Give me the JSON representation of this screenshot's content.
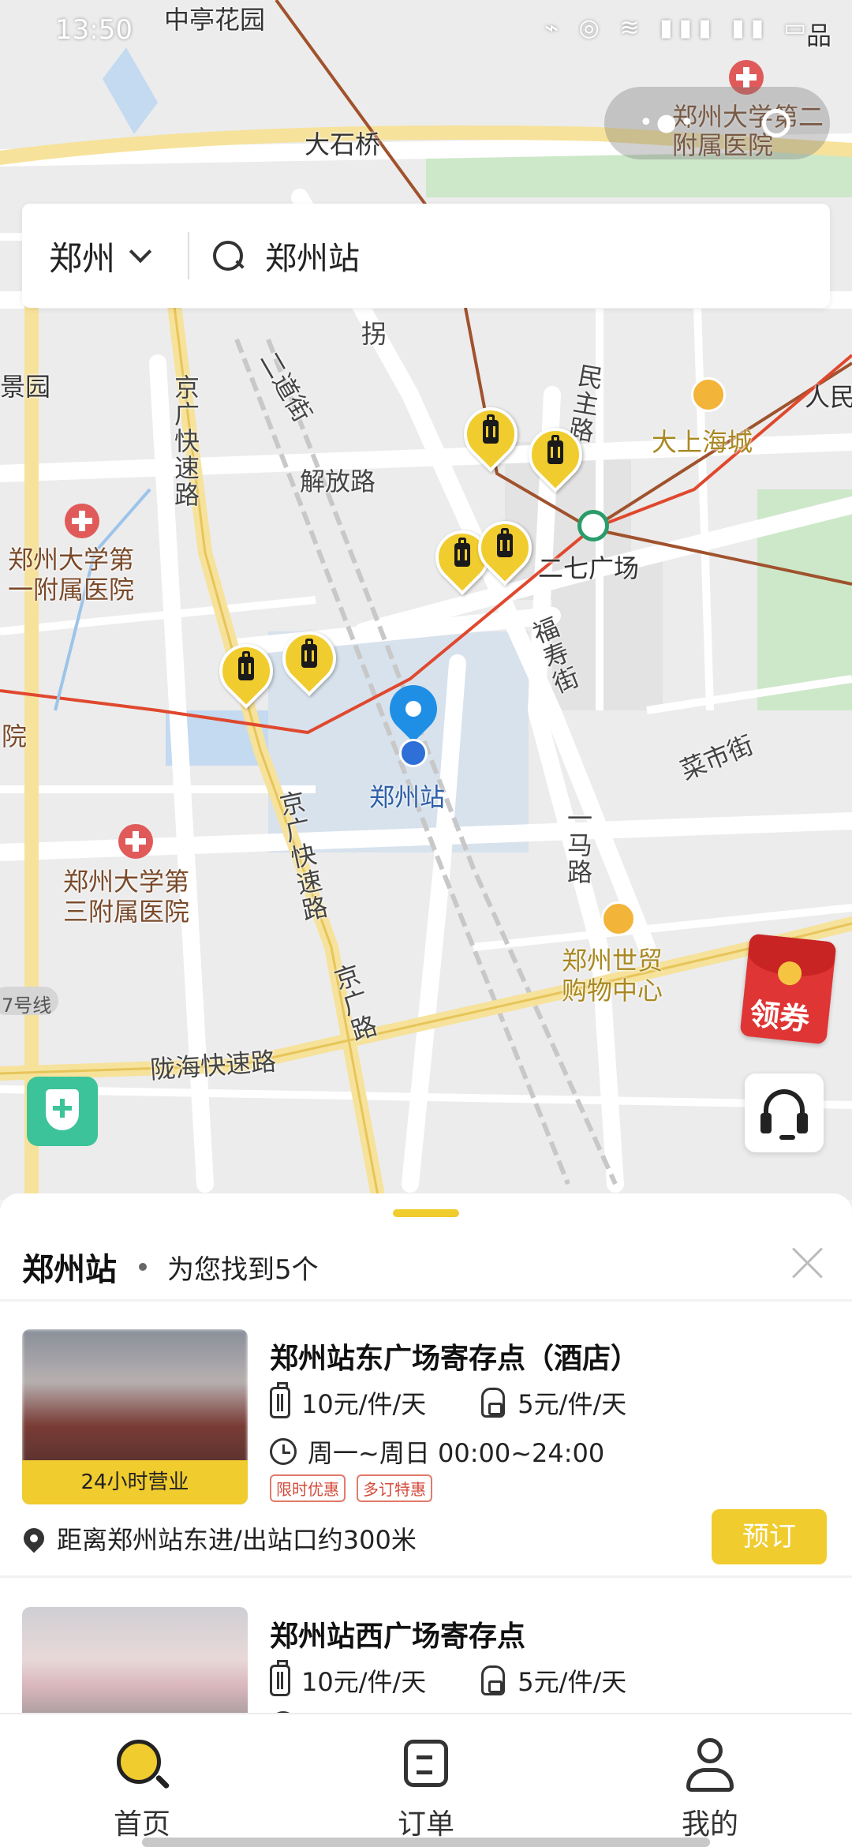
{
  "status_bar": {
    "time": "13:50",
    "icons": "⌁ ◎ ≋ ▮▮▮ ▮▮ ▭"
  },
  "search": {
    "city": "郑州",
    "query": "郑州站"
  },
  "map": {
    "labels": {
      "zhongting": "中亭花园",
      "dashiqiao": "大石桥",
      "hosp2": "郑州大学第二附属医院",
      "hosp1": "郑州大学第一附属医院",
      "hosp3": "郑州大学第三附属医院",
      "jinggang_exp1": "京广快速路",
      "jinggang_exp2": "京广快速路",
      "jinggang_rd": "京广路",
      "erdao": "二道街",
      "jiefang": "解放路",
      "minzhu": "民主路",
      "dashanghai": "大上海城",
      "erqi": "二七广场",
      "fushou": "福寿街",
      "caishi": "菜市街",
      "yima": "一马路",
      "shimao": "郑州世贸购物中心",
      "longhai": "陇海快速路",
      "station": "郑州站",
      "renmin": "人民",
      "jingyuan": "景园",
      "yuan": "院",
      "pinzhi": "品",
      "guai": "拐",
      "line7": "7号线"
    },
    "coupon_label": "领券",
    "colors": {
      "pin": "#f0cc2e",
      "metro_line": "#e0482e",
      "rail_line": "#a0522d"
    }
  },
  "panel": {
    "title": "郑州站",
    "count_text": "为您找到5个",
    "results": [
      {
        "name": "郑州站东广场寄存点（酒店）",
        "suitcase_price": "10元/件/天",
        "backpack_price": "5元/件/天",
        "hours": "周一~周日 00:00~24:00",
        "badge": "24小时营业",
        "tags": [
          "限时优惠",
          "多订特惠"
        ],
        "distance": "距离郑州站东进/出站口约300米",
        "book_label": "预订"
      },
      {
        "name": "郑州站西广场寄存点",
        "suitcase_price": "10元/件/天",
        "backpack_price": "5元/件/天"
      }
    ]
  },
  "tabs": [
    {
      "label": "首页",
      "icon": "home-search-icon"
    },
    {
      "label": "订单",
      "icon": "orders-icon"
    },
    {
      "label": "我的",
      "icon": "profile-icon"
    }
  ]
}
